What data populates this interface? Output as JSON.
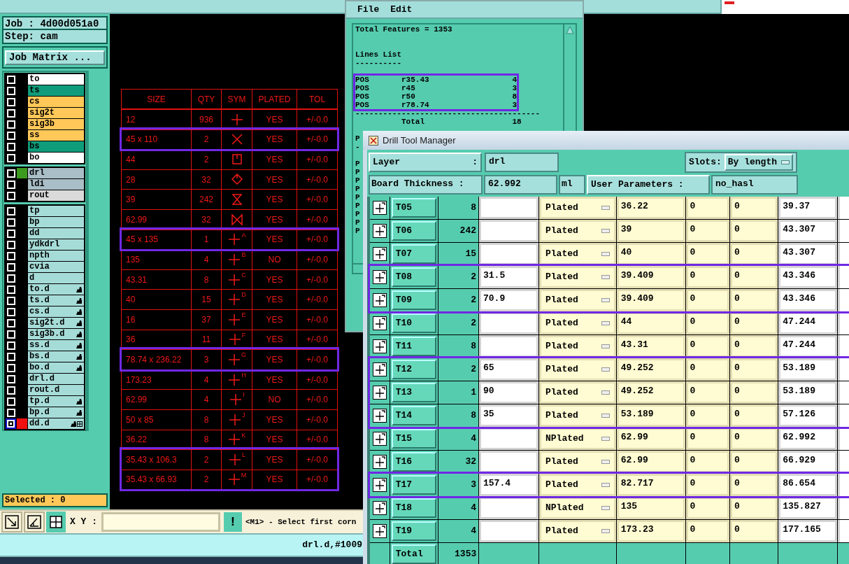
{
  "main_window": {
    "job": "Job : 4d00d051a0",
    "step": "Step: cam",
    "job_matrix_button": "Job Matrix ...",
    "layer_groups": [
      {
        "layers": [
          {
            "name": "to",
            "color": "#ffffff",
            "linked": false,
            "shown": false,
            "work_layer": false
          },
          {
            "name": "ts",
            "color": "#0f9c7a",
            "linked": false,
            "shown": false,
            "work_layer": false
          },
          {
            "name": "cs",
            "color": "#ffc858",
            "linked": false,
            "shown": false,
            "work_layer": false
          },
          {
            "name": "sig2t",
            "color": "#ffc858",
            "linked": false,
            "shown": false,
            "work_layer": false
          },
          {
            "name": "sig3b",
            "color": "#ffc858",
            "linked": false,
            "shown": false,
            "work_layer": false
          },
          {
            "name": "ss",
            "color": "#ffc858",
            "linked": false,
            "shown": false,
            "work_layer": false
          },
          {
            "name": "bs",
            "color": "#0f9c7a",
            "linked": false,
            "shown": false,
            "work_layer": false
          },
          {
            "name": "bo",
            "color": "#ffffff",
            "linked": false,
            "shown": false,
            "work_layer": false
          }
        ]
      },
      {
        "layers": [
          {
            "name": "drl",
            "color": "#a9bec6",
            "linked": false,
            "shown": true,
            "work_layer": false
          },
          {
            "name": "ldi",
            "color": "#a9bec6",
            "linked": false,
            "shown": false,
            "work_layer": false
          },
          {
            "name": "rout",
            "color": "#dadada",
            "linked": false,
            "shown": false,
            "work_layer": false
          }
        ]
      },
      {
        "layers": [
          {
            "name": "tp",
            "color": "#a6dcd8",
            "linked": false,
            "shown": false,
            "work_layer": false
          },
          {
            "name": "bp",
            "color": "#a6dcd8",
            "linked": false,
            "shown": false,
            "work_layer": false
          },
          {
            "name": "dd",
            "color": "#a6dcd8",
            "linked": false,
            "shown": false,
            "work_layer": false
          },
          {
            "name": "ydkdrl",
            "color": "#a6dcd8",
            "linked": false,
            "shown": false,
            "work_layer": false
          },
          {
            "name": "npth",
            "color": "#a6dcd8",
            "linked": false,
            "shown": false,
            "work_layer": false
          },
          {
            "name": "cvia",
            "color": "#a6dcd8",
            "linked": false,
            "shown": false,
            "work_layer": false
          },
          {
            "name": "d",
            "color": "#a6dcd8",
            "linked": false,
            "shown": false,
            "work_layer": false
          },
          {
            "name": "to.d",
            "color": "#a6dcd8",
            "linked": true,
            "shown": false,
            "work_layer": false
          },
          {
            "name": "ts.d",
            "color": "#a6dcd8",
            "linked": true,
            "shown": false,
            "work_layer": false
          },
          {
            "name": "cs.d",
            "color": "#a6dcd8",
            "linked": true,
            "shown": false,
            "work_layer": false
          },
          {
            "name": "sig2t.d",
            "color": "#a6dcd8",
            "linked": true,
            "shown": false,
            "work_layer": false
          },
          {
            "name": "sig3b.d",
            "color": "#a6dcd8",
            "linked": true,
            "shown": false,
            "work_layer": false
          },
          {
            "name": "ss.d",
            "color": "#a6dcd8",
            "linked": true,
            "shown": false,
            "work_layer": false
          },
          {
            "name": "bs.d",
            "color": "#a6dcd8",
            "linked": true,
            "shown": false,
            "work_layer": false
          },
          {
            "name": "bo.d",
            "color": "#a6dcd8",
            "linked": true,
            "shown": false,
            "work_layer": false
          },
          {
            "name": "drl.d",
            "color": "#a6dcd8",
            "linked": false,
            "shown": false,
            "work_layer": false
          },
          {
            "name": "rout.d",
            "color": "#a6dcd8",
            "linked": false,
            "shown": false,
            "work_layer": false
          },
          {
            "name": "tp.d",
            "color": "#a6dcd8",
            "linked": true,
            "shown": false,
            "work_layer": false
          },
          {
            "name": "bp.d",
            "color": "#a6dcd8",
            "linked": true,
            "shown": false,
            "work_layer": false
          },
          {
            "name": "dd.d",
            "color": "#a6dcd8",
            "linked": true,
            "shown": false,
            "work_layer": true
          }
        ]
      }
    ],
    "selected_count": "Selected : 0",
    "xy_label": "X Y :",
    "alert_button": "!",
    "message": "<M1> - Select first corn",
    "status": "drl.d,#1009"
  },
  "drill_table": {
    "columns": [
      "SIZE",
      "QTY",
      "SYM",
      "PLATED",
      "TOL"
    ],
    "rows": [
      {
        "size": "12",
        "qty": "936",
        "sym": {
          "kind": "plus"
        },
        "plated": "YES",
        "tol": "+/-0.0",
        "highlighted": false
      },
      {
        "size": "45 x 110",
        "qty": "2",
        "sym": {
          "kind": "x"
        },
        "plated": "YES",
        "tol": "+/-0.0",
        "highlighted": true
      },
      {
        "size": "44",
        "qty": "2",
        "sym": {
          "kind": "square"
        },
        "plated": "YES",
        "tol": "+/-0.0",
        "highlighted": false
      },
      {
        "size": "28",
        "qty": "32",
        "sym": {
          "kind": "diamond"
        },
        "plated": "YES",
        "tol": "+/-0.0",
        "highlighted": false
      },
      {
        "size": "39",
        "qty": "242",
        "sym": {
          "kind": "hourglass"
        },
        "plated": "YES",
        "tol": "+/-0.0",
        "highlighted": false
      },
      {
        "size": "62.99",
        "qty": "32",
        "sym": {
          "kind": "bowtie"
        },
        "plated": "YES",
        "tol": "+/-0.0",
        "highlighted": false
      },
      {
        "size": "45 x 135",
        "qty": "1",
        "sym": {
          "kind": "lettered",
          "letter": "A"
        },
        "plated": "YES",
        "tol": "+/-0.0",
        "highlighted": true
      },
      {
        "size": "135",
        "qty": "4",
        "sym": {
          "kind": "lettered",
          "letter": "B"
        },
        "plated": "NO",
        "tol": "+/-0.0",
        "highlighted": false
      },
      {
        "size": "43.31",
        "qty": "8",
        "sym": {
          "kind": "lettered",
          "letter": "C"
        },
        "plated": "YES",
        "tol": "+/-0.0",
        "highlighted": false
      },
      {
        "size": "40",
        "qty": "15",
        "sym": {
          "kind": "lettered",
          "letter": "D"
        },
        "plated": "YES",
        "tol": "+/-0.0",
        "highlighted": false
      },
      {
        "size": "16",
        "qty": "37",
        "sym": {
          "kind": "lettered",
          "letter": "E"
        },
        "plated": "YES",
        "tol": "+/-0.0",
        "highlighted": false
      },
      {
        "size": "36",
        "qty": "11",
        "sym": {
          "kind": "lettered",
          "letter": "F"
        },
        "plated": "YES",
        "tol": "+/-0.0",
        "highlighted": false
      },
      {
        "size": "78.74 x 236.22",
        "qty": "3",
        "sym": {
          "kind": "lettered",
          "letter": "G"
        },
        "plated": "YES",
        "tol": "+/-0.0",
        "highlighted": true
      },
      {
        "size": "173.23",
        "qty": "4",
        "sym": {
          "kind": "lettered",
          "letter": "H"
        },
        "plated": "YES",
        "tol": "+/-0.0",
        "highlighted": false
      },
      {
        "size": "62.99",
        "qty": "4",
        "sym": {
          "kind": "lettered",
          "letter": "I"
        },
        "plated": "NO",
        "tol": "+/-0.0",
        "highlighted": false
      },
      {
        "size": "50 x 85",
        "qty": "8",
        "sym": {
          "kind": "lettered",
          "letter": "J"
        },
        "plated": "YES",
        "tol": "+/-0.0",
        "highlighted": false
      },
      {
        "size": "36.22",
        "qty": "8",
        "sym": {
          "kind": "lettered",
          "letter": "K"
        },
        "plated": "YES",
        "tol": "+/-0.0",
        "highlighted": false
      },
      {
        "size": "35.43 x 106.3",
        "qty": "2",
        "sym": {
          "kind": "lettered",
          "letter": "L"
        },
        "plated": "YES",
        "tol": "+/-0.0",
        "highlighted": true
      },
      {
        "size": "35.43 x 66.93",
        "qty": "2",
        "sym": {
          "kind": "lettered",
          "letter": "M"
        },
        "plated": "YES",
        "tol": "+/-0.0",
        "highlighted": true
      }
    ]
  },
  "report_window": {
    "menu": [
      "File",
      "Edit"
    ],
    "lines": [
      {
        "kind": "text",
        "text": "Total Features = 1353",
        "highlighted": false
      },
      {
        "kind": "blank",
        "highlighted": false
      },
      {
        "kind": "blank",
        "highlighted": false
      },
      {
        "kind": "text",
        "text": "Lines List",
        "highlighted": false
      },
      {
        "kind": "text",
        "text": "----------",
        "highlighted": false
      },
      {
        "kind": "blank",
        "highlighted": false
      },
      {
        "kind": "text",
        "text": "POS       r35.43                  4",
        "highlighted": true
      },
      {
        "kind": "text",
        "text": "POS       r45                     3",
        "highlighted": true
      },
      {
        "kind": "text",
        "text": "POS       r50                     8",
        "highlighted": true
      },
      {
        "kind": "text",
        "text": "POS       r78.74                  3",
        "highlighted": true
      },
      {
        "kind": "text",
        "text": "----------------------------------------",
        "highlighted": false
      },
      {
        "kind": "text",
        "text": "          Total                   18",
        "highlighted": false
      },
      {
        "kind": "blank",
        "highlighted": false
      },
      {
        "kind": "text",
        "text": "P",
        "highlighted": false
      },
      {
        "kind": "text",
        "text": "-",
        "highlighted": false
      },
      {
        "kind": "blank",
        "highlighted": false
      },
      {
        "kind": "text",
        "text": "P",
        "highlighted": false
      },
      {
        "kind": "text",
        "text": "P",
        "highlighted": false
      },
      {
        "kind": "text",
        "text": "P",
        "highlighted": false
      },
      {
        "kind": "text",
        "text": "P",
        "highlighted": false
      },
      {
        "kind": "text",
        "text": "P",
        "highlighted": false
      },
      {
        "kind": "text",
        "text": "P",
        "highlighted": false
      },
      {
        "kind": "text",
        "text": "P",
        "highlighted": false
      },
      {
        "kind": "text",
        "text": "P",
        "highlighted": false
      },
      {
        "kind": "text",
        "text": "P",
        "highlighted": false
      }
    ]
  },
  "drill_manager": {
    "title": "Drill Tool Manager",
    "layer_label": "Layer",
    "layer_colon": ":",
    "layer_value": "drl",
    "slots_label": "Slots:",
    "slots_value": "By length",
    "thickness_label": "Board Thickness :",
    "thickness_value": "62.992",
    "thickness_unit": "ml",
    "user_params_label": "User Parameters :",
    "user_params_value": "no_hasl",
    "tools": [
      {
        "tool": "T05",
        "count": "8",
        "column_5": "Plated",
        "column_6": "36.22",
        "column_7": "0",
        "column_8": "0",
        "column_9": "39.37",
        "highlighted": false
      },
      {
        "tool": "T06",
        "count": "242",
        "column_5": "Plated",
        "column_6": "39",
        "column_7": "0",
        "column_8": "0",
        "column_9": "43.307",
        "highlighted": false
      },
      {
        "tool": "T07",
        "count": "15",
        "column_5": "Plated",
        "column_6": "40",
        "column_7": "0",
        "column_8": "0",
        "column_9": "43.307",
        "highlighted": false
      },
      {
        "tool": "T08",
        "count": "2",
        "column_4": "31.5",
        "column_5": "Plated",
        "column_6": "39.409",
        "column_7": "0",
        "column_8": "0",
        "column_9": "43.346",
        "highlighted": true
      },
      {
        "tool": "T09",
        "count": "2",
        "column_4": "70.9",
        "column_5": "Plated",
        "column_6": "39.409",
        "column_7": "0",
        "column_8": "0",
        "column_9": "43.346",
        "highlighted": true
      },
      {
        "tool": "T10",
        "count": "2",
        "column_5": "Plated",
        "column_6": "44",
        "column_7": "0",
        "column_8": "0",
        "column_9": "47.244",
        "highlighted": false
      },
      {
        "tool": "T11",
        "count": "8",
        "column_5": "Plated",
        "column_6": "43.31",
        "column_7": "0",
        "column_8": "0",
        "column_9": "47.244",
        "highlighted": false
      },
      {
        "tool": "T12",
        "count": "2",
        "column_4": "65",
        "column_5": "Plated",
        "column_6": "49.252",
        "column_7": "0",
        "column_8": "0",
        "column_9": "53.189",
        "highlighted": true
      },
      {
        "tool": "T13",
        "count": "1",
        "column_4": "90",
        "column_5": "Plated",
        "column_6": "49.252",
        "column_7": "0",
        "column_8": "0",
        "column_9": "53.189",
        "highlighted": true
      },
      {
        "tool": "T14",
        "count": "8",
        "column_4": "35",
        "column_5": "Plated",
        "column_6": "53.189",
        "column_7": "0",
        "column_8": "0",
        "column_9": "57.126",
        "highlighted": true
      },
      {
        "tool": "T15",
        "count": "4",
        "column_5": "NPlated",
        "column_6": "62.99",
        "column_7": "0",
        "column_8": "0",
        "column_9": "62.992",
        "highlighted": false
      },
      {
        "tool": "T16",
        "count": "32",
        "column_5": "Plated",
        "column_6": "62.99",
        "column_7": "0",
        "column_8": "0",
        "column_9": "66.929",
        "highlighted": false
      },
      {
        "tool": "T17",
        "count": "3",
        "column_4": "157.4",
        "column_5": "Plated",
        "column_6": "82.717",
        "column_7": "0",
        "column_8": "0",
        "column_9": "86.654",
        "highlighted": true
      },
      {
        "tool": "T18",
        "count": "4",
        "column_5": "NPlated",
        "column_6": "135",
        "column_7": "0",
        "column_8": "0",
        "column_9": "135.827",
        "highlighted": false
      },
      {
        "tool": "T19",
        "count": "4",
        "column_5": "Plated",
        "column_6": "173.23",
        "column_7": "0",
        "column_8": "0",
        "column_9": "177.165",
        "highlighted": false
      }
    ],
    "total_label": "Total",
    "total_count": "1353"
  }
}
